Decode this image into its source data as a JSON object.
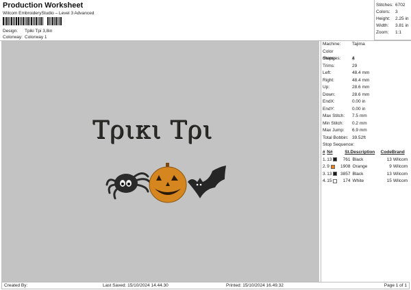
{
  "header": {
    "title": "Production Worksheet",
    "subtitle": "Wilcom EmbroideryStudio – Level 3 Advanced",
    "design_label": "Design:",
    "design_value": "Tpiki Tpi 3,8in",
    "colorway_label": "Colorway:",
    "colorway_value": "Colorway 1"
  },
  "summary": [
    {
      "k": "Stitches:",
      "v": "6702"
    },
    {
      "k": "Colors:",
      "v": "3"
    },
    {
      "k": "Height:",
      "v": "2.25 in"
    },
    {
      "k": "Width:",
      "v": "3.81 in"
    },
    {
      "k": "Zoom:",
      "v": "1:1"
    }
  ],
  "details": [
    {
      "k": "Machine:",
      "v": "Tajima"
    },
    {
      "k": "Color changes:",
      "v": "3"
    },
    {
      "k": "Stops:",
      "v": "4"
    },
    {
      "k": "Trims:",
      "v": "29"
    },
    {
      "k": "Left:",
      "v": "48.4 mm"
    },
    {
      "k": "Right:",
      "v": "48.4 mm"
    },
    {
      "k": "Up:",
      "v": "28.6 mm"
    },
    {
      "k": "Down:",
      "v": "28.6 mm"
    },
    {
      "k": "EndX:",
      "v": "0.00 in"
    },
    {
      "k": "EndY:",
      "v": "0.00 in"
    },
    {
      "k": "Max Stitch:",
      "v": "7.5 mm"
    },
    {
      "k": "Min Stitch:",
      "v": "0.2 mm"
    },
    {
      "k": "Max Jump:",
      "v": "6.9 mm"
    },
    {
      "k": "Total Bobbin:",
      "v": "39.52ft"
    }
  ],
  "stop_sequence": {
    "title": "Stop Sequence:",
    "headers": [
      "#",
      "N#",
      "St.",
      "Description",
      "Code",
      "Brand"
    ],
    "rows": [
      {
        "n": "1.",
        "needle": "13",
        "color": "#1a1a1a",
        "st": "761",
        "desc": "Black",
        "code": "13",
        "brand": "Wilcom"
      },
      {
        "n": "2.",
        "needle": "9",
        "color": "#e8821e",
        "st": "1908",
        "desc": "Orange",
        "code": "9",
        "brand": "Wilcom"
      },
      {
        "n": "3.",
        "needle": "13",
        "color": "#1a1a1a",
        "st": "3857",
        "desc": "Black",
        "code": "13",
        "brand": "Wilcom"
      },
      {
        "n": "4.",
        "needle": "15",
        "color": "#ffffff",
        "st": "174",
        "desc": "White",
        "code": "15",
        "brand": "Wilcom"
      }
    ]
  },
  "design": {
    "lettering": "Τρικι Τρι"
  },
  "footer": {
    "created": "Created By:",
    "saved": "Last Saved: 15/10/2024 14.44.30",
    "printed": "Printed: 15/10/2024 16.49.32",
    "page": "Page 1 of 1"
  }
}
